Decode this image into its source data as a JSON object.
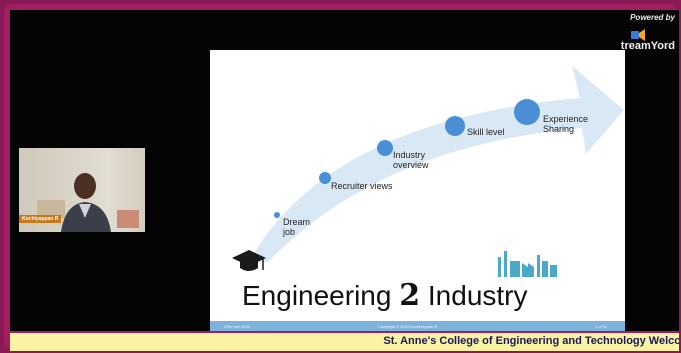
{
  "branding": {
    "powered_by": "Powered by",
    "logo_text": "treamYord"
  },
  "participant": {
    "name_tag": "Kochiyappan R"
  },
  "slide": {
    "milestones": [
      {
        "label": "Dream\njob"
      },
      {
        "label": "Recruiter views"
      },
      {
        "label": "Industry\noverview"
      },
      {
        "label": "Skill level"
      },
      {
        "label": "Experience\nSharing"
      }
    ],
    "title_left": "Engineering",
    "title_number": "2",
    "title_right": "Industry",
    "footer_left": "29th Nov 2020",
    "footer_center": "Copyright © 2020 Kochiyappan R",
    "footer_right": "1 of 11"
  },
  "ticker": {
    "text": "St. Anne's College of Engineering and Technology Welco"
  },
  "colors": {
    "frame": "#a11f60",
    "arrow": "#d9e8f5",
    "dot": "#4a8fd6",
    "ticker_bg": "#fbf3a4",
    "ticker_text": "#18185a"
  }
}
